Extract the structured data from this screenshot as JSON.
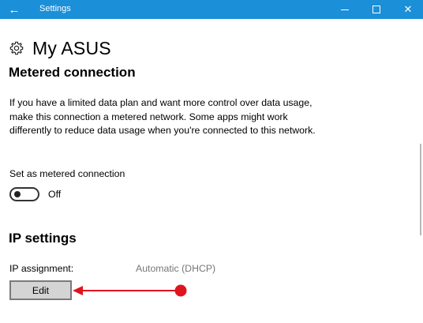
{
  "window": {
    "title": "Settings",
    "back_icon": "back-arrow-icon",
    "titlebar_color": "#1b8fd8"
  },
  "page": {
    "title": "My ASUS",
    "icon": "gear-icon"
  },
  "metered": {
    "heading": "Metered connection",
    "description": "If you have a limited data plan and want more control over data usage, make this connection a metered network. Some apps might work differently to reduce data usage when you're connected to this network.",
    "toggle_label": "Set as metered connection",
    "toggle_state": "Off"
  },
  "ip": {
    "heading": "IP settings",
    "assignment_label": "IP assignment:",
    "assignment_value": "Automatic (DHCP)",
    "edit_label": "Edit"
  },
  "annotation": {
    "color": "#e0141e"
  }
}
